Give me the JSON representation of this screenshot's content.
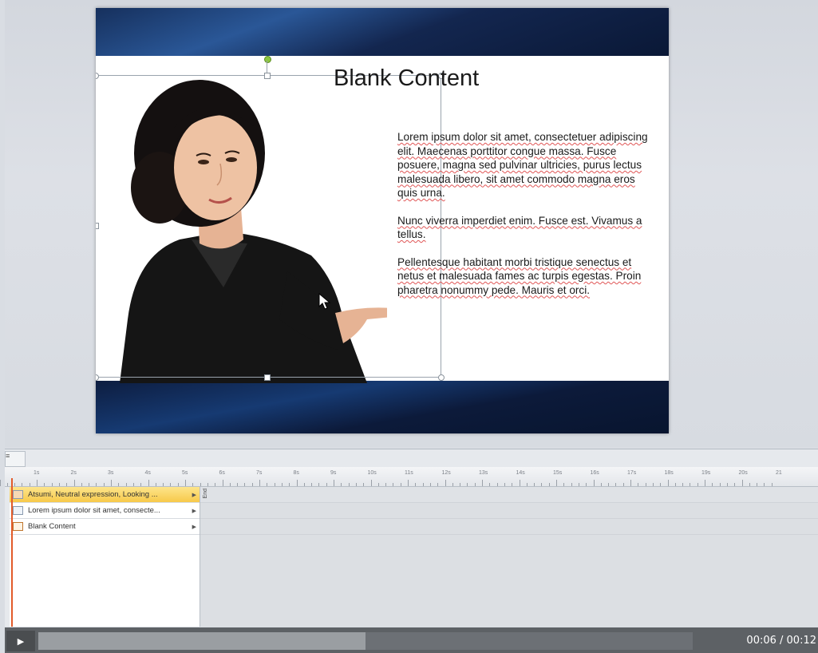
{
  "slide": {
    "title": "Blank Content",
    "paragraphs": [
      "Lorem ipsum dolor sit amet, consectetuer adipiscing elit. Maecenas porttitor congue massa. Fusce posuere, magna sed pulvinar ultricies, purus lectus malesuada libero, sit amet commodo magna eros quis urna.",
      "Nunc viverra imperdiet enim. Fusce est. Vivamus a tellus.",
      "Pellentesque habitant morbi tristique senectus et netus et malesuada fames ac turpis egestas. Proin pharetra nonummy pede. Mauris et orci."
    ]
  },
  "timeline": {
    "tab_label": "≡",
    "ruler_labels": [
      "1s",
      "2s",
      "3s",
      "4s",
      "5s",
      "6s",
      "7s",
      "8s",
      "9s",
      "10s",
      "11s",
      "12s",
      "13s",
      "14s",
      "15s",
      "16s",
      "17s",
      "18s",
      "19s",
      "20s",
      "21"
    ],
    "rows": [
      {
        "label": "Atsumi, Neutral expression, Looking ...",
        "icon": "character-icon",
        "active": true
      },
      {
        "label": "Lorem ipsum dolor sit amet, consecte...",
        "icon": "text-icon",
        "active": false
      },
      {
        "label": "Blank Content",
        "icon": "slide-icon",
        "active": false
      }
    ],
    "end_label": "End"
  },
  "player": {
    "play_label": "▶",
    "time": "00:06 / 00:12",
    "progress": 0.5
  },
  "colors": {
    "accent_row": "#f7c94a",
    "slide_band": "#163a72",
    "playhead": "#e25b2a"
  }
}
